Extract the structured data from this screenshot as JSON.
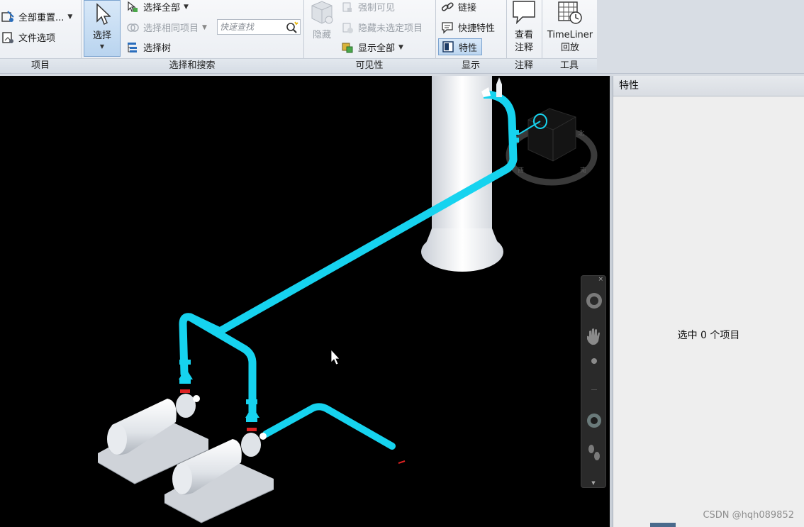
{
  "ribbon": {
    "groups": {
      "project": "项目",
      "select_search": "选择和搜索",
      "visibility": "可见性",
      "display": "显示",
      "annotation": "注释",
      "tools": "工具"
    },
    "project": {
      "reset_all": "全部重置...",
      "file_options": "文件选项"
    },
    "select_search": {
      "select": "选择",
      "select_all": "选择全部",
      "select_same": "选择相同项目",
      "selection_tree": "选择树",
      "quick_find_placeholder": "快速查找"
    },
    "visibility": {
      "hide": "隐藏",
      "require": "强制可见",
      "hide_unselected": "隐藏未选定项目",
      "unhide_all": "显示全部"
    },
    "display": {
      "links": "链接",
      "quick_properties": "快捷特性",
      "properties": "特性"
    },
    "annotation": {
      "view_comments_line1": "查看",
      "view_comments_line2": "注释"
    },
    "tools": {
      "timeliner_line1": "TimeLiner",
      "timeliner_line2": "回放"
    }
  },
  "properties_panel": {
    "title": "特性",
    "message": "选中 0 个项目"
  },
  "watermark": "CSDN @hqh089852",
  "colors": {
    "pipe": "#16d3ef",
    "viewport_bg": "#000000",
    "toggle_blue": "#bcd6f0"
  }
}
